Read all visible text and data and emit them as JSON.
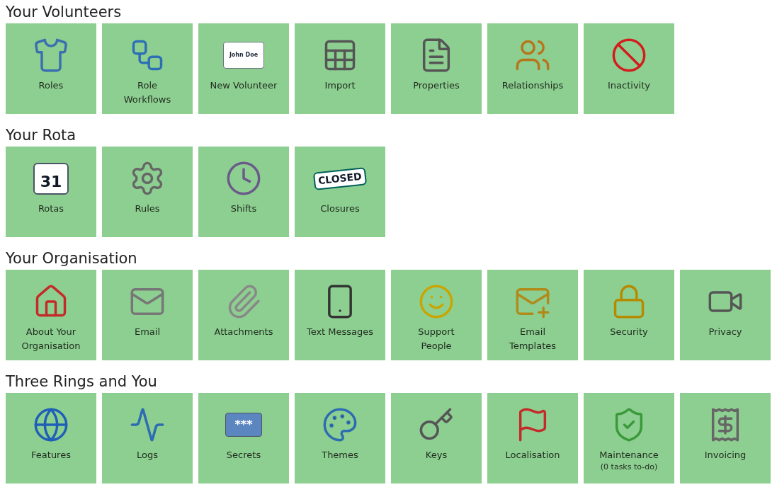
{
  "sections": [
    {
      "heading": "Your Volunteers",
      "tiles": [
        {
          "label": "Roles"
        },
        {
          "label": "Role Workflows"
        },
        {
          "label": "New Volunteer",
          "icon_text": "John Doe"
        },
        {
          "label": "Import"
        },
        {
          "label": "Properties"
        },
        {
          "label": "Relationships"
        },
        {
          "label": "Inactivity"
        }
      ]
    },
    {
      "heading": "Your Rota",
      "tiles": [
        {
          "label": "Rotas",
          "icon_text": "31"
        },
        {
          "label": "Rules"
        },
        {
          "label": "Shifts"
        },
        {
          "label": "Closures",
          "icon_text": "CLOSED"
        }
      ]
    },
    {
      "heading": "Your Organisation",
      "tiles": [
        {
          "label": "About Your Organisation"
        },
        {
          "label": "Email"
        },
        {
          "label": "Attachments"
        },
        {
          "label": "Text Messages"
        },
        {
          "label": "Support People"
        },
        {
          "label": "Email Templates"
        },
        {
          "label": "Security"
        },
        {
          "label": "Privacy"
        }
      ]
    },
    {
      "heading": "Three Rings and You",
      "tiles": [
        {
          "label": "Features"
        },
        {
          "label": "Logs"
        },
        {
          "label": "Secrets",
          "icon_text": "***"
        },
        {
          "label": "Themes"
        },
        {
          "label": "Keys"
        },
        {
          "label": "Localisation"
        },
        {
          "label": "Maintenance",
          "note": "(0 tasks to-do)"
        },
        {
          "label": "Invoicing"
        }
      ]
    }
  ]
}
